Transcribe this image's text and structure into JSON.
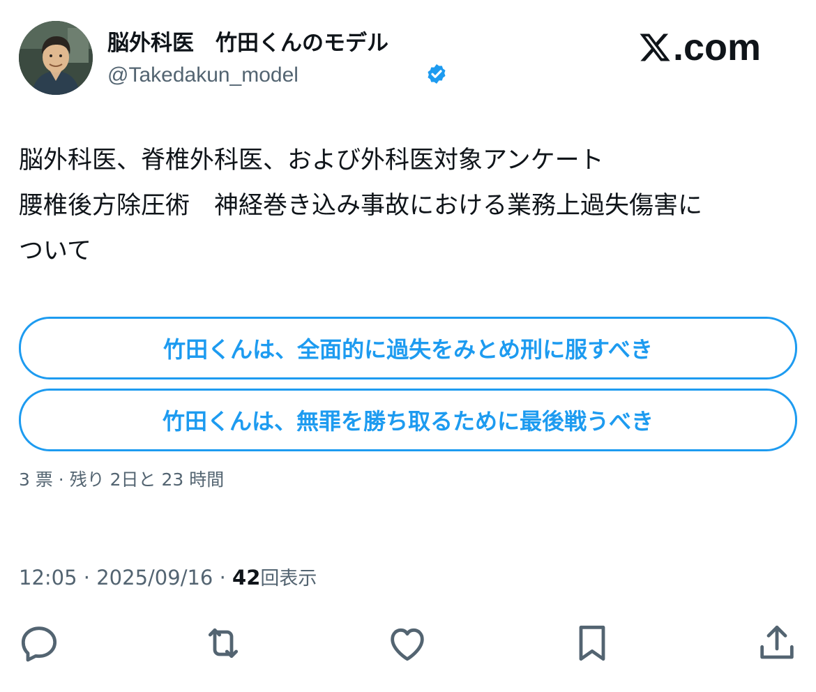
{
  "user": {
    "display_name": "脳外科医　竹田くんのモデル",
    "handle": "@Takedakun_model",
    "verified": true,
    "avatar": "avatar-illustration"
  },
  "brand": {
    "logo_text": ".com",
    "logo_icon": "x-logo-icon"
  },
  "tweet": {
    "lines": [
      "脳外科医、脊椎外科医、および外科医対象アンケート",
      "腰椎後方除圧術　神経巻き込み事故における業務上過失傷害に",
      "ついて"
    ]
  },
  "poll": {
    "options": [
      {
        "label": "竹田くんは、全面的に過失をみとめ刑に服すべき"
      },
      {
        "label": "竹田くんは、無罪を勝ち取るために最後戦うべき"
      }
    ],
    "meta": "3 票 · 残り 2日と 23 時間"
  },
  "timestamp": {
    "time_date": "12:05 · 2025/09/16 · ",
    "views_count": "42",
    "views_label": "回表示"
  },
  "actions": [
    {
      "name": "reply",
      "icon": "reply-icon"
    },
    {
      "name": "retweet",
      "icon": "retweet-icon"
    },
    {
      "name": "like",
      "icon": "heart-icon"
    },
    {
      "name": "bookmark",
      "icon": "bookmark-icon"
    },
    {
      "name": "share",
      "icon": "share-icon"
    }
  ],
  "colors": {
    "accent": "#1d9bf0",
    "text_primary": "#0f1419",
    "text_secondary": "#536471"
  }
}
